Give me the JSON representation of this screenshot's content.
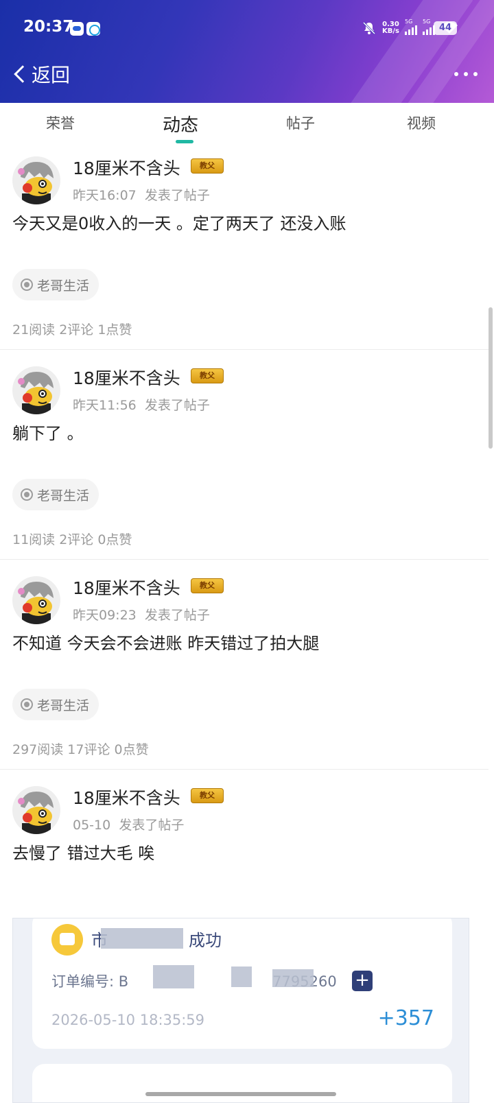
{
  "status_bar": {
    "time": "20:37",
    "speed_value": "0.30",
    "speed_unit": "KB/s",
    "signal1_label": "5G",
    "signal2_label": "5G",
    "battery": "44"
  },
  "nav": {
    "back_label": "返回"
  },
  "tabs": [
    {
      "label": "荣誉"
    },
    {
      "label": "动态"
    },
    {
      "label": "帖子"
    },
    {
      "label": "视频"
    }
  ],
  "posts": [
    {
      "username": "18厘米不含头",
      "badge": "教父",
      "time": "昨天16:07",
      "action": "发表了帖子",
      "content": "今天又是0收入的一天 。定了两天了 还没入账",
      "tag": "老哥生活",
      "stats": "21阅读 2评论 1点赞"
    },
    {
      "username": "18厘米不含头",
      "badge": "教父",
      "time": "昨天11:56",
      "action": "发表了帖子",
      "content": "躺下了 。",
      "tag": "老哥生活",
      "stats": "11阅读 2评论 0点赞"
    },
    {
      "username": "18厘米不含头",
      "badge": "教父",
      "time": "昨天09:23",
      "action": "发表了帖子",
      "content": "不知道 今天会不会进账 昨天错过了拍大腿",
      "tag": "老哥生活",
      "stats": "297阅读 17评论 0点赞"
    },
    {
      "username": "18厘米不含头",
      "badge": "教父",
      "time": "05-10",
      "action": "发表了帖子",
      "content": "去慢了 错过大毛 唉"
    }
  ],
  "attachment": {
    "title_prefix": "市",
    "title_suffix": "成功",
    "order_prefix": "订单编号: B",
    "order_suffix": "7795260",
    "date": "2026-05-10 18:35:59",
    "amount": "+357"
  },
  "colors": {
    "accent": "#20b8a3",
    "amount": "#2c8ed6",
    "badge": "#e0a82a"
  }
}
